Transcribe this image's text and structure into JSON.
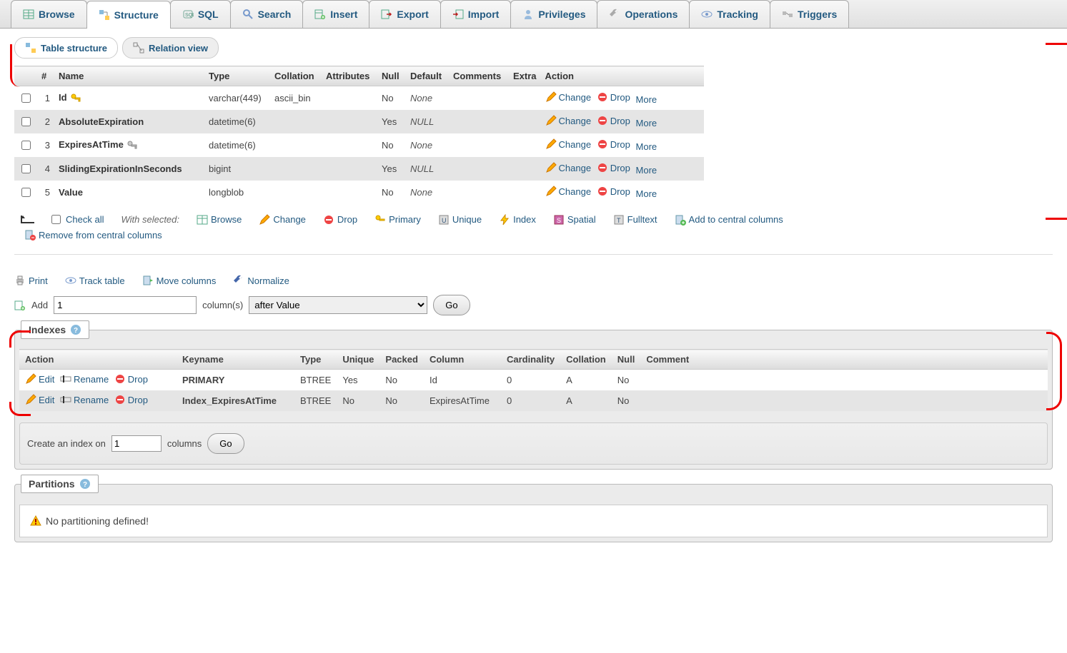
{
  "tabs": {
    "browse": "Browse",
    "structure": "Structure",
    "sql": "SQL",
    "search": "Search",
    "insert": "Insert",
    "export": "Export",
    "import": "Import",
    "privileges": "Privileges",
    "operations": "Operations",
    "tracking": "Tracking",
    "triggers": "Triggers"
  },
  "subtabs": {
    "table_structure": "Table structure",
    "relation_view": "Relation view"
  },
  "columns_headers": {
    "num": "#",
    "name": "Name",
    "type": "Type",
    "collation": "Collation",
    "attributes": "Attributes",
    "null": "Null",
    "default": "Default",
    "comments": "Comments",
    "extra": "Extra",
    "action": "Action"
  },
  "rows": [
    {
      "num": "1",
      "name": "Id",
      "icon": "key-primary",
      "type": "varchar(449)",
      "collation": "ascii_bin",
      "null": "No",
      "default": "None",
      "default_italic": true
    },
    {
      "num": "2",
      "name": "AbsoluteExpiration",
      "type": "datetime(6)",
      "null": "Yes",
      "default": "NULL",
      "default_italic": true
    },
    {
      "num": "3",
      "name": "ExpiresAtTime",
      "icon": "key-index",
      "type": "datetime(6)",
      "null": "No",
      "default": "None",
      "default_italic": true
    },
    {
      "num": "4",
      "name": "SlidingExpirationInSeconds",
      "type": "bigint",
      "null": "Yes",
      "default": "NULL",
      "default_italic": true
    },
    {
      "num": "5",
      "name": "Value",
      "type": "longblob",
      "null": "No",
      "default": "None",
      "default_italic": true
    }
  ],
  "row_actions": {
    "change": "Change",
    "drop": "Drop",
    "more": "More"
  },
  "bulk": {
    "check_all": "Check all",
    "with_selected": "With selected:",
    "browse": "Browse",
    "change": "Change",
    "drop": "Drop",
    "primary": "Primary",
    "unique": "Unique",
    "index": "Index",
    "spatial": "Spatial",
    "fulltext": "Fulltext",
    "add_central": "Add to central columns",
    "remove_central": "Remove from central columns"
  },
  "util": {
    "print": "Print",
    "track": "Track table",
    "move": "Move columns",
    "normalize": "Normalize"
  },
  "add": {
    "label": "Add",
    "value": "1",
    "columns": "column(s)",
    "after": "after Value",
    "go": "Go"
  },
  "indexes": {
    "title": "Indexes",
    "headers": {
      "action": "Action",
      "keyname": "Keyname",
      "type": "Type",
      "unique": "Unique",
      "packed": "Packed",
      "column": "Column",
      "cardinality": "Cardinality",
      "collation": "Collation",
      "null": "Null",
      "comment": "Comment"
    },
    "row_actions": {
      "edit": "Edit",
      "rename": "Rename",
      "drop": "Drop"
    },
    "rows": [
      {
        "keyname": "PRIMARY",
        "type": "BTREE",
        "unique": "Yes",
        "packed": "No",
        "column": "Id",
        "cardinality": "0",
        "collation": "A",
        "null": "No",
        "comment": ""
      },
      {
        "keyname": "Index_ExpiresAtTime",
        "type": "BTREE",
        "unique": "No",
        "packed": "No",
        "column": "ExpiresAtTime",
        "cardinality": "0",
        "collation": "A",
        "null": "No",
        "comment": ""
      }
    ],
    "create": {
      "label_pre": "Create an index on",
      "value": "1",
      "label_post": "columns",
      "go": "Go"
    }
  },
  "partitions": {
    "title": "Partitions",
    "warning": "No partitioning defined!"
  }
}
